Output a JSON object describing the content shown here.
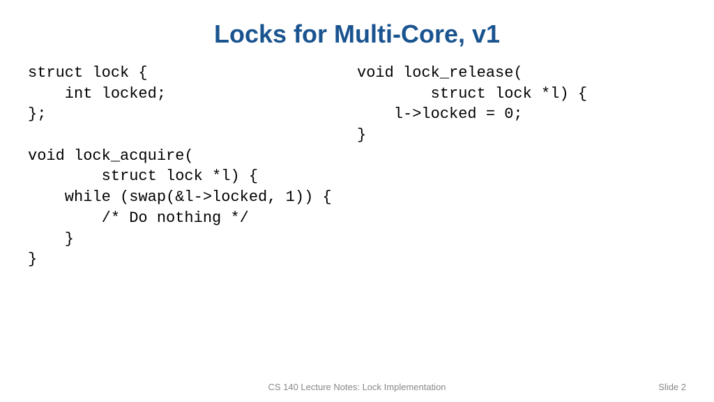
{
  "title": "Locks for Multi-Core, v1",
  "code_left": "struct lock {\n    int locked;\n};\n\nvoid lock_acquire(\n        struct lock *l) {\n    while (swap(&l->locked, 1)) {\n        /* Do nothing */\n    }\n}",
  "code_right": "void lock_release(\n        struct lock *l) {\n    l->locked = 0;\n}",
  "footer": {
    "center": "CS 140 Lecture Notes: Lock Implementation",
    "right": "Slide 2"
  }
}
